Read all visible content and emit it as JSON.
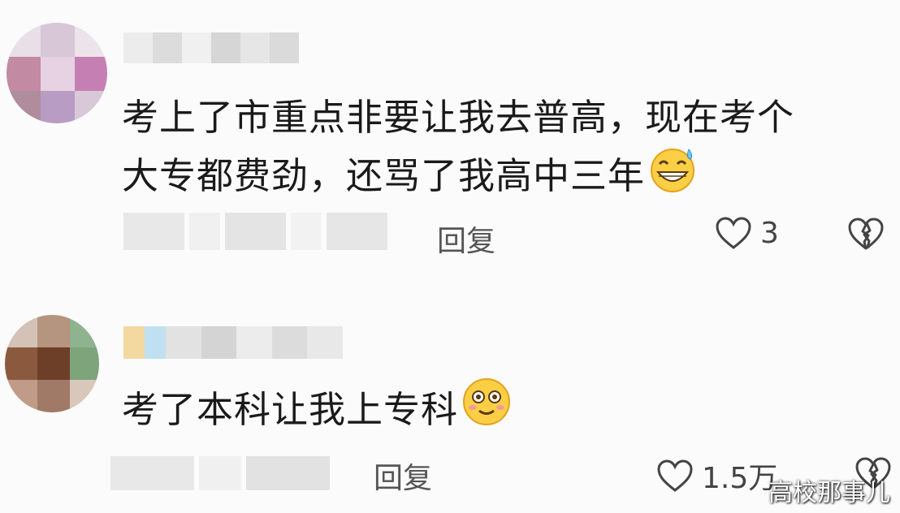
{
  "comments": [
    {
      "text_line1": "考上了市重点非要让我去普高，现在考个",
      "text_line2": "大专都费劲，还骂了我高中三年",
      "emoji": "grinning-sweat-emoji",
      "reply_label": "回复",
      "like_count": "3"
    },
    {
      "text_line1": "考了本科让我上专科",
      "emoji": "smiling-blush-emoji",
      "reply_label": "回复",
      "like_count": "1.5万"
    }
  ],
  "watermark": "高校那事儿",
  "icons": {
    "like": "heart-outline-icon",
    "dislike": "broken-heart-icon"
  }
}
